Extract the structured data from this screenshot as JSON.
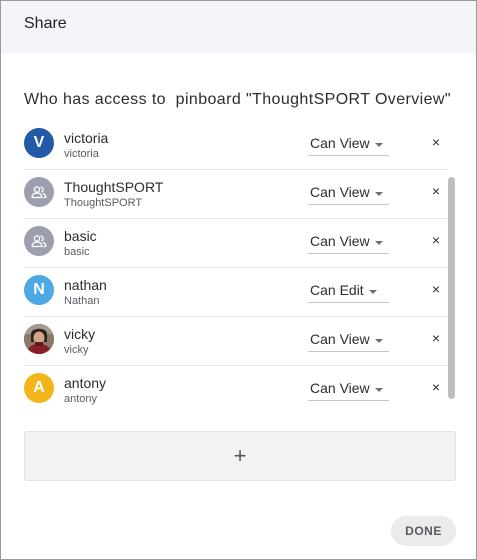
{
  "header": {
    "title": "Share"
  },
  "subtitle": "Who has access to  pinboard \"ThoughtSPORT Overview\"",
  "members": [
    {
      "avatar": "letter",
      "letter": "V",
      "color": "#2359a6",
      "name": "victoria",
      "username": "victoria",
      "permission": "Can View"
    },
    {
      "avatar": "group-icon",
      "letter": "",
      "color": "#9d9fb0",
      "name": "ThoughtSPORT",
      "username": "ThoughtSPORT",
      "permission": "Can View"
    },
    {
      "avatar": "group-icon",
      "letter": "",
      "color": "#9d9fb0",
      "name": "basic",
      "username": "basic",
      "permission": "Can View"
    },
    {
      "avatar": "letter",
      "letter": "N",
      "color": "#4da8e4",
      "name": "nathan",
      "username": "Nathan",
      "permission": "Can Edit"
    },
    {
      "avatar": "photo",
      "letter": "",
      "color": "#6b5a4e",
      "name": "vicky",
      "username": "vicky",
      "permission": "Can View"
    },
    {
      "avatar": "letter",
      "letter": "A",
      "color": "#f4b51c",
      "name": "antony",
      "username": "antony",
      "permission": "Can View"
    }
  ],
  "remove_label": "×",
  "add_label": "+",
  "done_label": "DONE"
}
